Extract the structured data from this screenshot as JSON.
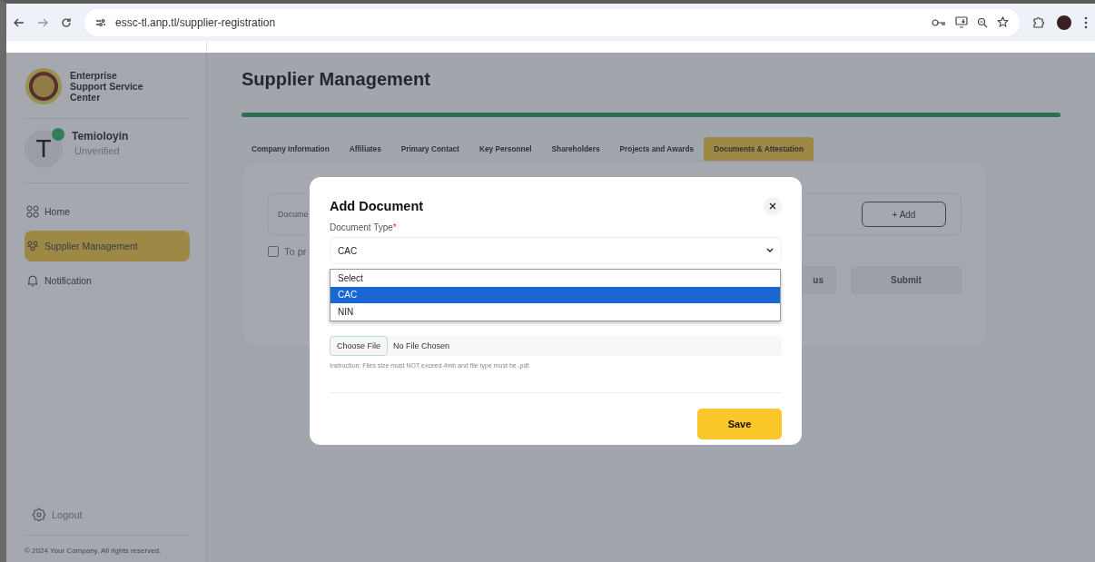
{
  "browser": {
    "url": "essc-tl.anp.tl/supplier-registration"
  },
  "sidebar": {
    "brand": "Enterprise Support Service Center",
    "user": {
      "initial": "T",
      "name": "Temioloyin",
      "status": "Unverified",
      "online": true
    },
    "items": [
      {
        "label": "Home",
        "selected": false
      },
      {
        "label": "Supplier Management",
        "selected": true
      },
      {
        "label": "Notification",
        "selected": false
      }
    ],
    "logout": "Logout",
    "footer": "© 2024 Your Company. All rights reserved."
  },
  "page": {
    "title": "Supplier Management",
    "progress": {
      "level": 1
    },
    "tabs": [
      {
        "label": "Company Information",
        "selected": false
      },
      {
        "label": "Affiliates",
        "selected": false
      },
      {
        "label": "Primary Contact",
        "selected": false
      },
      {
        "label": "Key Personnel",
        "selected": false
      },
      {
        "label": "Shareholders",
        "selected": false
      },
      {
        "label": "Projects and Awards",
        "selected": false
      },
      {
        "label": "Documents & Attestation",
        "selected": true
      }
    ],
    "document_field": {
      "placeholder": "Docume"
    },
    "add_button": "+ Add",
    "consent": {
      "label": "To pr",
      "checked": false
    },
    "buttons": [
      "us",
      "Submit"
    ]
  },
  "modal": {
    "title": "Add Document",
    "field_label": "Document Type",
    "required_mark": "*",
    "value": "CAC",
    "options": [
      {
        "label": "Select",
        "selected": false
      },
      {
        "label": "CAC",
        "selected": true
      },
      {
        "label": "NIN",
        "selected": false
      }
    ],
    "file_button": "Choose File",
    "file_status": "No File Chosen",
    "instruction": "Instruction: Files size must NOT exceed 4mb and file type must be .pdf.",
    "save": "Save"
  }
}
